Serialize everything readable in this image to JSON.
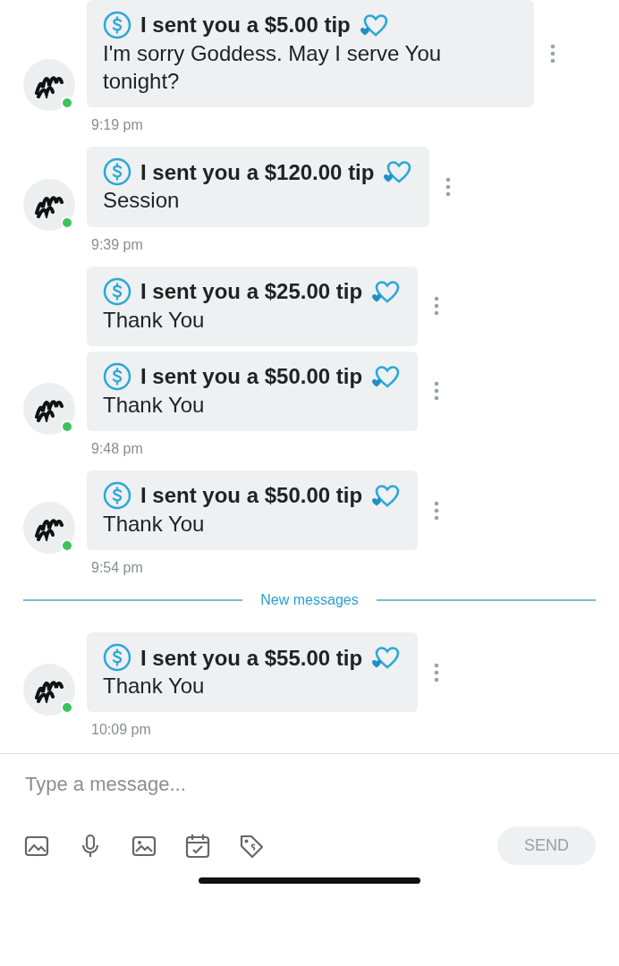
{
  "messages": [
    {
      "avatar": {
        "online": true
      },
      "bubbles": [
        {
          "tip": "I sent you a $5.00 tip",
          "text": "I'm sorry Goddess. May I serve You tonight?"
        }
      ],
      "time": "9:19 pm"
    },
    {
      "avatar": {
        "online": true
      },
      "bubbles": [
        {
          "tip": "I sent you a $120.00 tip",
          "text": "Session"
        }
      ],
      "time": "9:39 pm"
    },
    {
      "avatar": {
        "online": true
      },
      "bubbles": [
        {
          "tip": "I sent you a $25.00 tip",
          "text": "Thank You"
        },
        {
          "tip": "I sent you a $50.00 tip",
          "text": "Thank You"
        }
      ],
      "time": "9:48 pm"
    },
    {
      "avatar": {
        "online": true
      },
      "bubbles": [
        {
          "tip": "I sent you a $50.00 tip",
          "text": "Thank You"
        }
      ],
      "time": "9:54 pm"
    }
  ],
  "divider": {
    "label": "New messages"
  },
  "new_messages": [
    {
      "avatar": {
        "online": true
      },
      "bubbles": [
        {
          "tip": "I sent you a $55.00 tip",
          "text": "Thank You"
        }
      ],
      "time": "10:09 pm"
    }
  ],
  "composer": {
    "placeholder": "Type a message..."
  },
  "toolbar": {
    "send_button": {
      "label": "SEND",
      "disabled": true
    }
  }
}
